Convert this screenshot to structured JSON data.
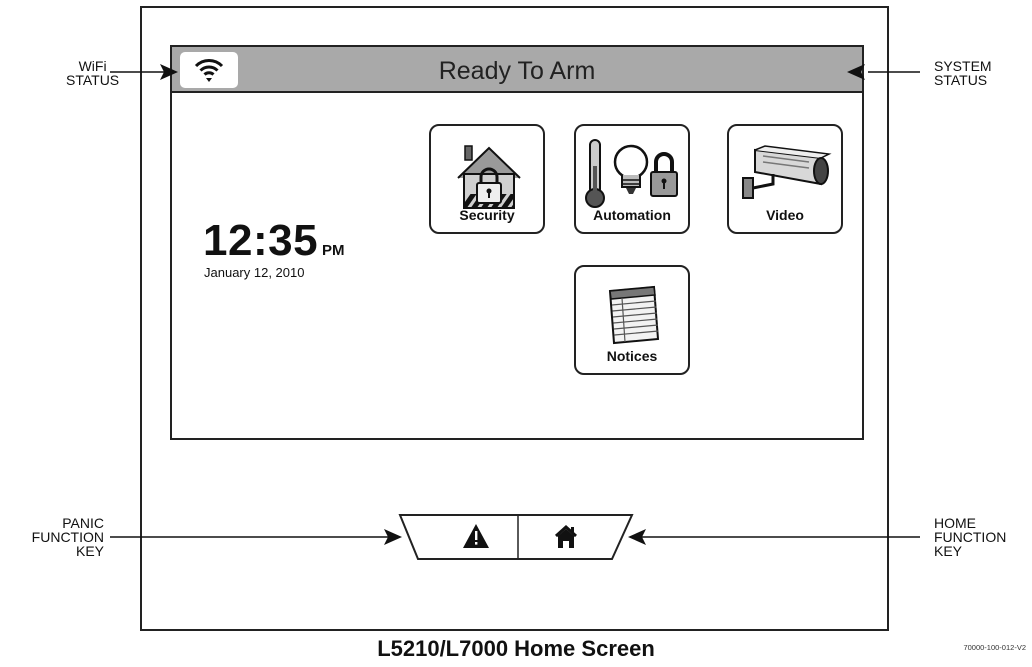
{
  "status_bar": {
    "system_status": "Ready To Arm"
  },
  "clock": {
    "time": "12:35",
    "ampm": "PM",
    "date": "January 12, 2010"
  },
  "tiles": {
    "security": "Security",
    "automation": "Automation",
    "video": "Video",
    "notices": "Notices"
  },
  "callouts": {
    "wifi": [
      "WiFi",
      "STATUS"
    ],
    "system": [
      "SYSTEM",
      "STATUS"
    ],
    "panic": [
      "PANIC",
      "FUNCTION",
      "KEY"
    ],
    "home": [
      "HOME",
      "FUNCTION",
      "KEY"
    ]
  },
  "caption": "L5210/L7000 Home Screen",
  "document_code": "70000-100-012-V2",
  "icons": {
    "wifi": "wifi-icon",
    "panic": "warning-triangle-icon",
    "home": "house-icon"
  }
}
